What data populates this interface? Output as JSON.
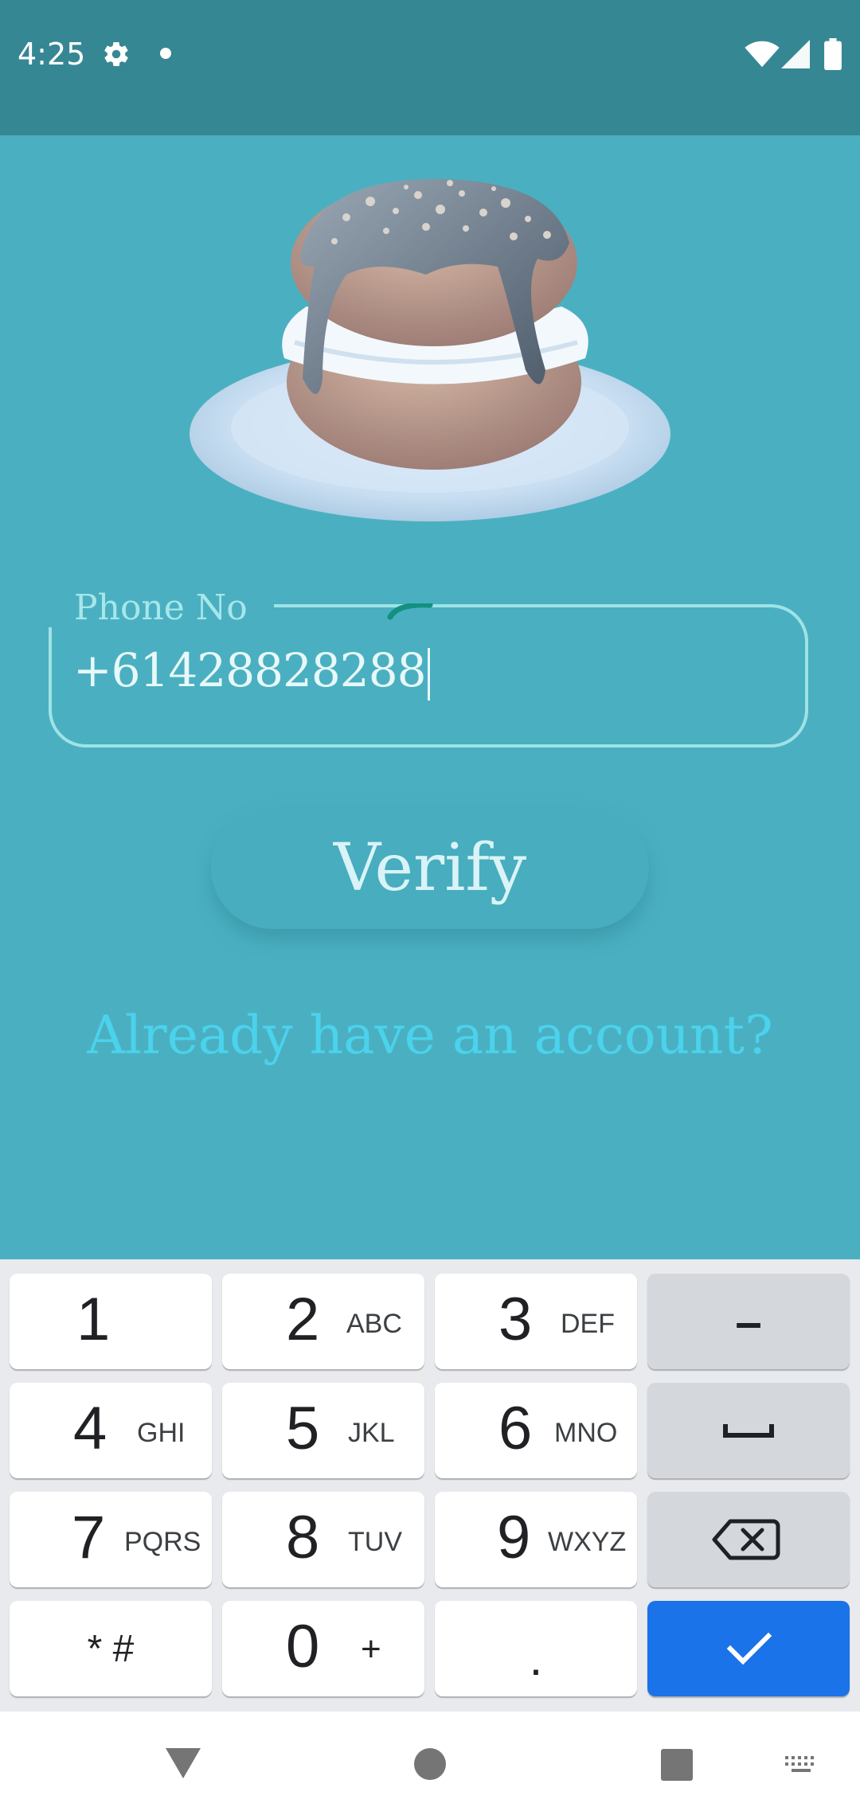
{
  "status_bar": {
    "time": "4:25",
    "icons": [
      "gear-icon",
      "notification-dot-icon",
      "wifi-icon",
      "cell-signal-icon",
      "battery-icon"
    ]
  },
  "form": {
    "phone_label": "Phone No",
    "phone_value": "+61428828288",
    "verify_label": "Verify",
    "login_link": "Already have an account?"
  },
  "keyboard": {
    "keys": [
      {
        "digit": "1",
        "letters": ""
      },
      {
        "digit": "2",
        "letters": "ABC"
      },
      {
        "digit": "3",
        "letters": "DEF"
      },
      {
        "digit": "4",
        "letters": "GHI"
      },
      {
        "digit": "5",
        "letters": "JKL"
      },
      {
        "digit": "6",
        "letters": "MNO"
      },
      {
        "digit": "7",
        "letters": "PQRS"
      },
      {
        "digit": "8",
        "letters": "TUV"
      },
      {
        "digit": "9",
        "letters": "WXYZ"
      },
      {
        "digit": "0",
        "letters": "+"
      }
    ],
    "star_hash": "* #",
    "dash": "–",
    "period": "."
  },
  "colors": {
    "background": "#4ab0c1",
    "status_bar": "#368794",
    "accent_link": "#4bd2ec",
    "enter_key": "#1a73e8"
  }
}
